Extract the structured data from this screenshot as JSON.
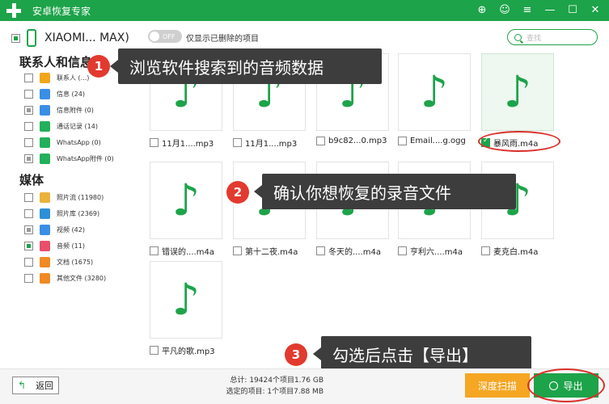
{
  "window": {
    "title": "安卓恢复专家"
  },
  "device": {
    "name": "XIAOMI... MAX)"
  },
  "toggle": {
    "state": "OFF",
    "label": "仅显示已删除的项目"
  },
  "search": {
    "placeholder": "查找"
  },
  "sidebar": {
    "contacts_heading": "联系人和信息",
    "contacts_items": [
      {
        "label": "联系人 (...)",
        "color": "#f2a51a"
      },
      {
        "label": "信息 (24)",
        "color": "#3a8ee6"
      },
      {
        "label": "信息附件 (0)",
        "color": "#3a8ee6"
      },
      {
        "label": "通话记录 (14)",
        "color": "#22b05a"
      },
      {
        "label": "WhatsApp (0)",
        "color": "#22b05a"
      },
      {
        "label": "WhatsApp附件 (0)",
        "color": "#22b05a"
      }
    ],
    "media_heading": "媒体",
    "media_items": [
      {
        "label": "照片流 (11980)",
        "color": "#e9b23a"
      },
      {
        "label": "照片库 (2369)",
        "color": "#2d8fd6"
      },
      {
        "label": "视频 (42)",
        "color": "#3a8ee6"
      },
      {
        "label": "音频 (11)",
        "color": "#e94e6b"
      },
      {
        "label": "文档 (1675)",
        "color": "#f08a24"
      },
      {
        "label": "其他文件 (3280)",
        "color": "#f08a24"
      }
    ]
  },
  "files": [
    {
      "name": "11月1....mp3",
      "checked": false
    },
    {
      "name": "11月1....mp3",
      "checked": false
    },
    {
      "name": "b9c82...0.mp3",
      "checked": false
    },
    {
      "name": "Email....g.ogg",
      "checked": false
    },
    {
      "name": "暴风雨.m4a",
      "checked": true
    },
    {
      "name": "错误的....m4a",
      "checked": false
    },
    {
      "name": "第十二夜.m4a",
      "checked": false
    },
    {
      "name": "冬天的....m4a",
      "checked": false
    },
    {
      "name": "亨利六....m4a",
      "checked": false
    },
    {
      "name": "麦克白.m4a",
      "checked": false
    },
    {
      "name": "平凡的歌.mp3",
      "checked": false
    }
  ],
  "callouts": [
    {
      "num": "1",
      "text": "浏览软件搜索到的音频数据"
    },
    {
      "num": "2",
      "text": "确认你想恢复的录音文件"
    },
    {
      "num": "3",
      "text": "勾选后点击【导出】"
    }
  ],
  "footer": {
    "back_label": "返回",
    "total": "总计: 19424个项目1.76 GB",
    "selected": "选定的项目: 1个项目7.88 MB",
    "deep_scan": "深度扫描",
    "export": "导出"
  },
  "colors": {
    "accent": "#1da34a",
    "orange": "#f5a623",
    "highlight": "#d9302a"
  }
}
